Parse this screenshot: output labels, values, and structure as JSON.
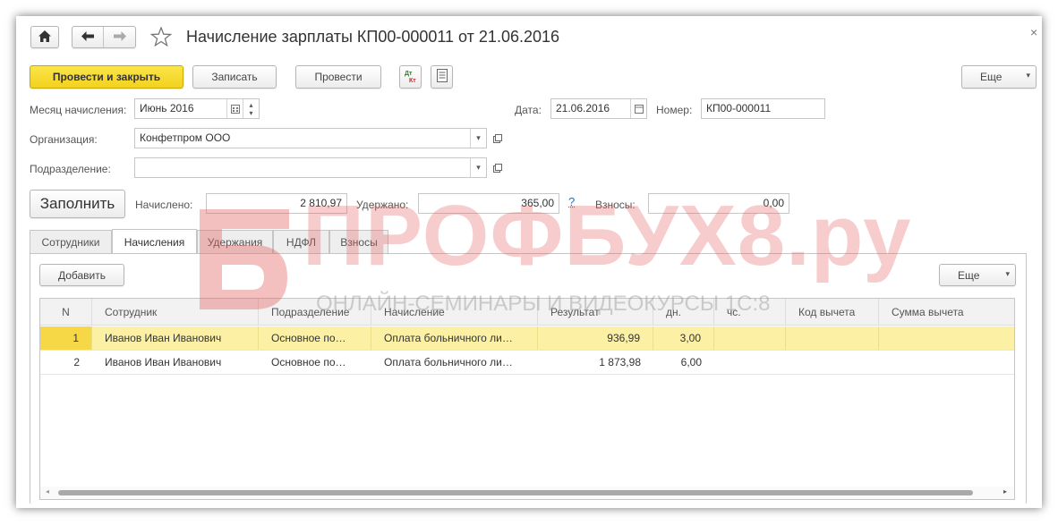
{
  "window": {
    "title": "Начисление зарплаты КП00-000011 от 21.06.2016",
    "close_glyph": "×"
  },
  "toolbar": {
    "post_close_label": "Провести и закрыть",
    "save_label": "Записать",
    "post_label": "Провести",
    "more_label": "Еще"
  },
  "form": {
    "month_label": "Месяц начисления:",
    "month_value": "Июнь 2016",
    "date_label": "Дата:",
    "date_value": "21.06.2016",
    "number_label": "Номер:",
    "number_value": "КП00-000011",
    "org_label": "Организация:",
    "org_value": "Конфетпром ООО",
    "dept_label": "Подразделение:",
    "dept_value": "",
    "fill_label": "Заполнить",
    "accrued_label": "Начислено:",
    "accrued_value": "2 810,97",
    "withheld_label": "Удержано:",
    "withheld_value": "365,00",
    "help_glyph": "?",
    "contrib_label": "Взносы:",
    "contrib_value": "0,00"
  },
  "tabs": [
    {
      "label": "Сотрудники"
    },
    {
      "label": "Начисления"
    },
    {
      "label": "Удержания"
    },
    {
      "label": "НДФЛ"
    },
    {
      "label": "Взносы"
    }
  ],
  "table_toolbar": {
    "add_label": "Добавить",
    "more_label": "Еще"
  },
  "table": {
    "headers": [
      "N",
      "Сотрудник",
      "Подразделение",
      "Начисление",
      "Результат",
      "дн.",
      "чс.",
      "Код вычета",
      "Сумма вычета"
    ],
    "rows": [
      [
        "1",
        "Иванов Иван Иванович",
        "Основное по…",
        "Оплата больничного ли…",
        "936,99",
        "3,00",
        "",
        "",
        ""
      ],
      [
        "2",
        "Иванов Иван Иванович",
        "Основное по…",
        "Оплата больничного ли…",
        "1 873,98",
        "6,00",
        "",
        "",
        ""
      ]
    ]
  },
  "watermark": {
    "brand": "ПРОФБУХ8.ру",
    "tagline": "ОНЛАЙН-СЕМИНАРЫ И ВИДЕОКУРСЫ 1С:8"
  },
  "colors": {
    "accent_yellow": "#f3d11f",
    "selected_row": "#fbf0a3",
    "watermark_red": "#e35a5a"
  }
}
